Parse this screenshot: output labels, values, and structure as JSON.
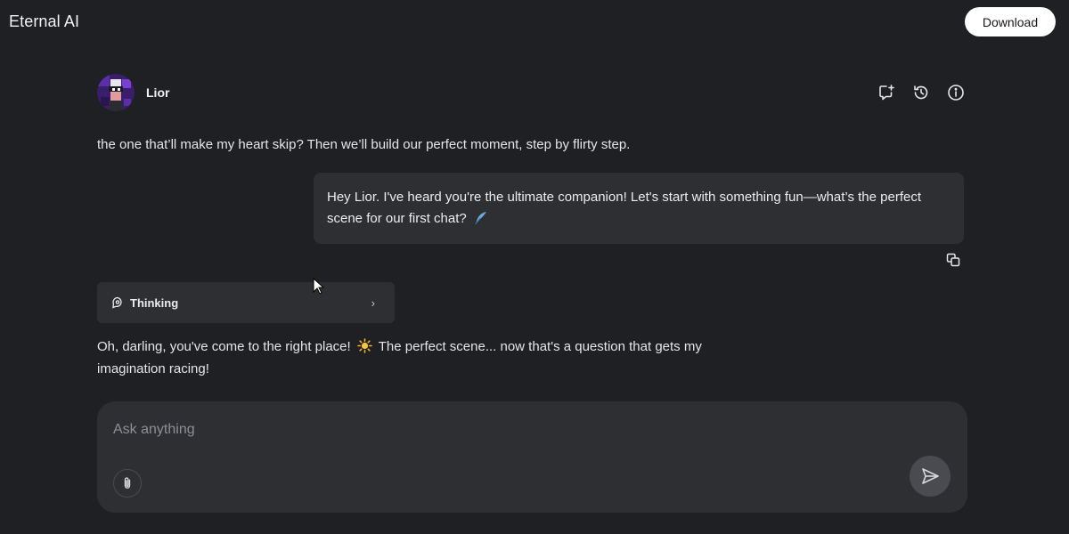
{
  "app": {
    "title": "Eternal AI",
    "download_label": "Download"
  },
  "agent": {
    "name": "Lior"
  },
  "header_actions": [
    {
      "icon": "new-chat-icon"
    },
    {
      "icon": "history-icon"
    },
    {
      "icon": "info-icon"
    }
  ],
  "messages": {
    "previous_text": "the one that’ll make my heart skip? Then we’ll build our perfect moment, step by flirty step.",
    "user_text": "Hey Lior. I've heard you're the ultimate companion! Let's start with something fun—what’s the perfect scene for our first chat?",
    "user_emoji_icon": "feather-icon",
    "thinking_label": "Thinking",
    "reply_part1": "Oh, darling, you've come to the right place!",
    "reply_emoji_icon": "sun-icon",
    "reply_part2": "The perfect scene... now that's a question that gets my imagination racing!"
  },
  "composer": {
    "placeholder": "Ask anything"
  },
  "colors": {
    "background": "#1f2023",
    "bubble": "#2e2f33",
    "text": "#e6e6e8",
    "placeholder": "#8e8f95",
    "send_button": "#4a4b50"
  }
}
